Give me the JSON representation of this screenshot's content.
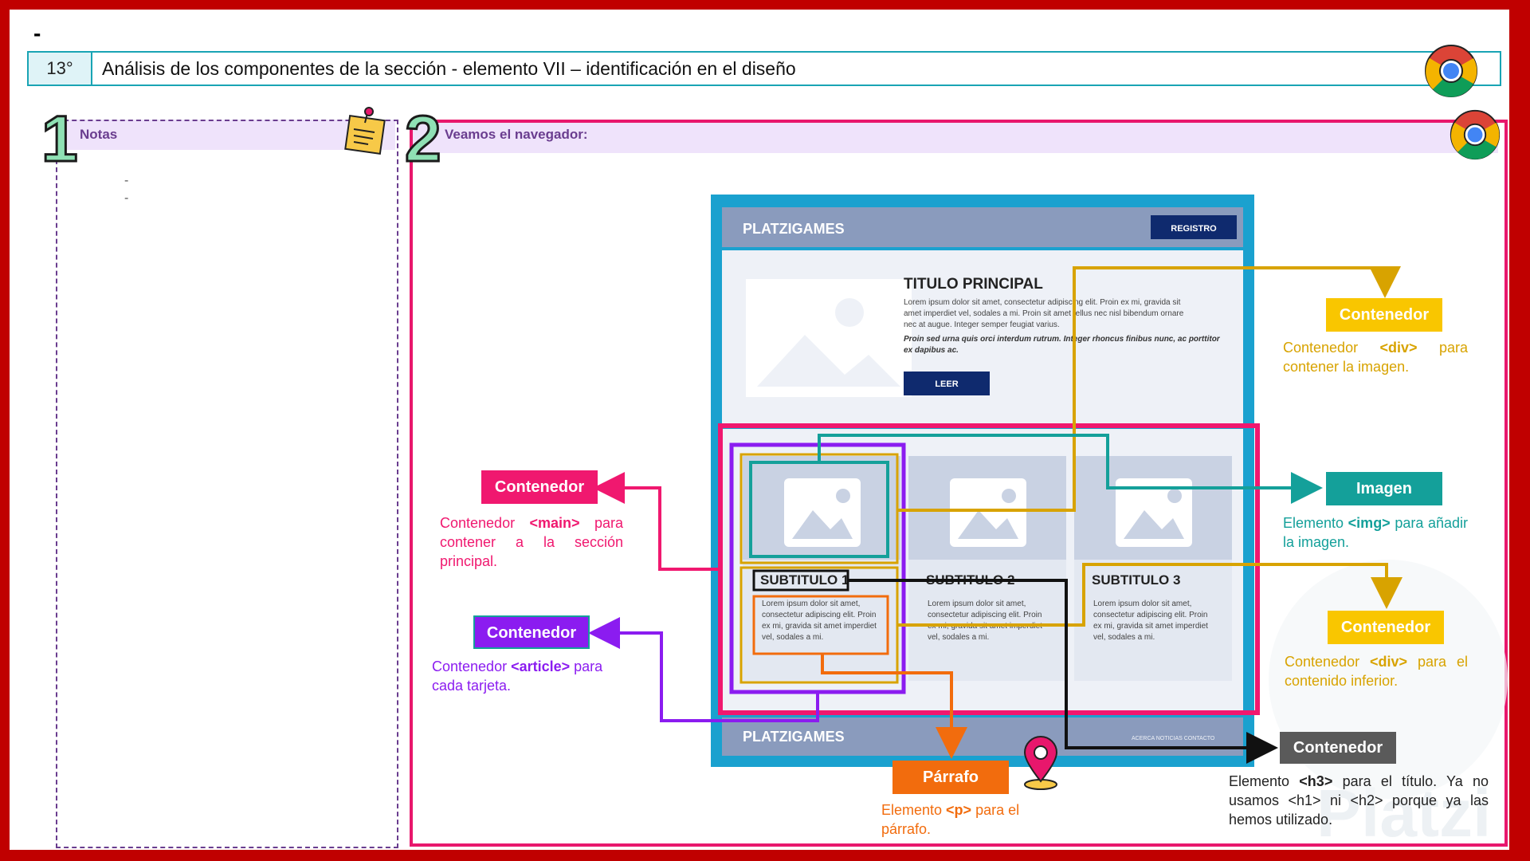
{
  "header": {
    "dash": "-",
    "number": "13°",
    "title": "Análisis de los componentes de la sección   - elemento VII – identificación en el diseño"
  },
  "notes": {
    "number": "1",
    "label": "Notas",
    "items": [
      "-",
      "-"
    ]
  },
  "browser": {
    "number": "2",
    "label": "Veamos el navegador:"
  },
  "mockup": {
    "brand": "PLATZIGAMES",
    "register_button": "REGISTRO",
    "main_title": "TITULO PRINCIPAL",
    "lorem_lines": [
      "Lorem ipsum dolor sit amet, consectetur adipiscing elit. Proin ex mi, gravida sit",
      "amet imperdiet vel, sodales a mi. Proin sit amet tellus nec nisl bibendum ornare",
      "nec at augue. Integer semper feugiat varius."
    ],
    "lorem_italic_lines": [
      "Proin sed urna quis orci interdum rutrum. Integer rhoncus finibus nunc, ac porttitor",
      "ex dapibus ac."
    ],
    "read_button": "LEER",
    "cards": [
      {
        "subtitle": "SUBTITULO 1"
      },
      {
        "subtitle": "SUBTITULO 2"
      },
      {
        "subtitle": "SUBTITULO 3"
      }
    ],
    "card_text_lines": [
      "Lorem ipsum dolor sit amet,",
      "consectetur adipiscing elit. Proin",
      "ex mi, gravida sit amet imperdiet",
      "vel, sodales a mi."
    ],
    "footer_brand": "PLATZIGAMES",
    "footer_links": "ACERCA  NOTICIAS  CONTACTO"
  },
  "annotations": {
    "main": {
      "label": "Contenedor",
      "desc_prefix": "Contenedor ",
      "tag": "<main>",
      "desc_suffix": " para contener a la sección principal.",
      "color": "#f0186f"
    },
    "article": {
      "label": "Contenedor",
      "desc_prefix": "Contenedor ",
      "tag": "<article>",
      "desc_suffix": " para cada tarjeta.",
      "color": "#8b1cf0"
    },
    "div_image": {
      "label": "Contenedor",
      "desc_prefix": "Contenedor ",
      "tag": "<div>",
      "desc_suffix": " para contener la imagen.",
      "color": "#d8a300"
    },
    "img": {
      "label": "Imagen",
      "desc_prefix": "Elemento ",
      "tag": "<img>",
      "desc_suffix": " para añadir la imagen.",
      "color": "#14a09a"
    },
    "div_bottom": {
      "label": "Contenedor",
      "desc_prefix": "Contenedor ",
      "tag": "<div>",
      "desc_suffix": " para el contenido inferior.",
      "color": "#d8a300"
    },
    "h3": {
      "label": "Contenedor",
      "desc_prefix": "Elemento ",
      "tag": "<h3>",
      "desc_suffix": " para el título. Ya no usamos <h1> ni <h2> porque ya las hemos utilizado.",
      "color": "#5a5a5a"
    },
    "p": {
      "label": "Párrafo",
      "desc_prefix": "Elemento ",
      "tag": "<p>",
      "desc_suffix": " para el párrafo.",
      "color": "#f26c0d"
    }
  },
  "watermark": "Platzi"
}
